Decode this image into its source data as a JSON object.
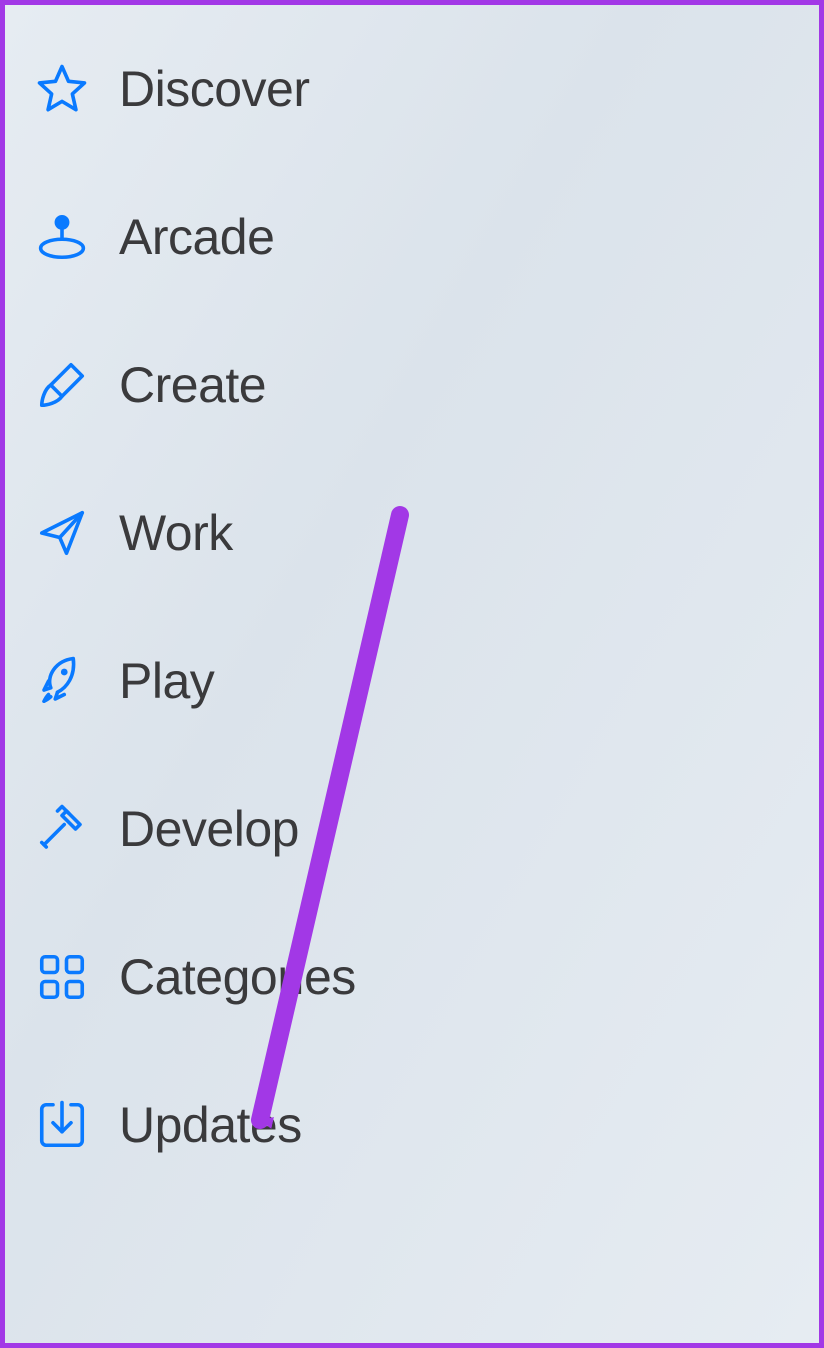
{
  "sidebar": {
    "items": [
      {
        "label": "Discover",
        "icon": "star-icon"
      },
      {
        "label": "Arcade",
        "icon": "arcade-icon"
      },
      {
        "label": "Create",
        "icon": "paintbrush-icon"
      },
      {
        "label": "Work",
        "icon": "paperplane-icon"
      },
      {
        "label": "Play",
        "icon": "rocket-icon"
      },
      {
        "label": "Develop",
        "icon": "hammer-icon"
      },
      {
        "label": "Categories",
        "icon": "grid-icon"
      },
      {
        "label": "Updates",
        "icon": "download-icon"
      }
    ]
  },
  "annotation": {
    "color": "#a238e6",
    "target": "sidebar-item-updates"
  }
}
